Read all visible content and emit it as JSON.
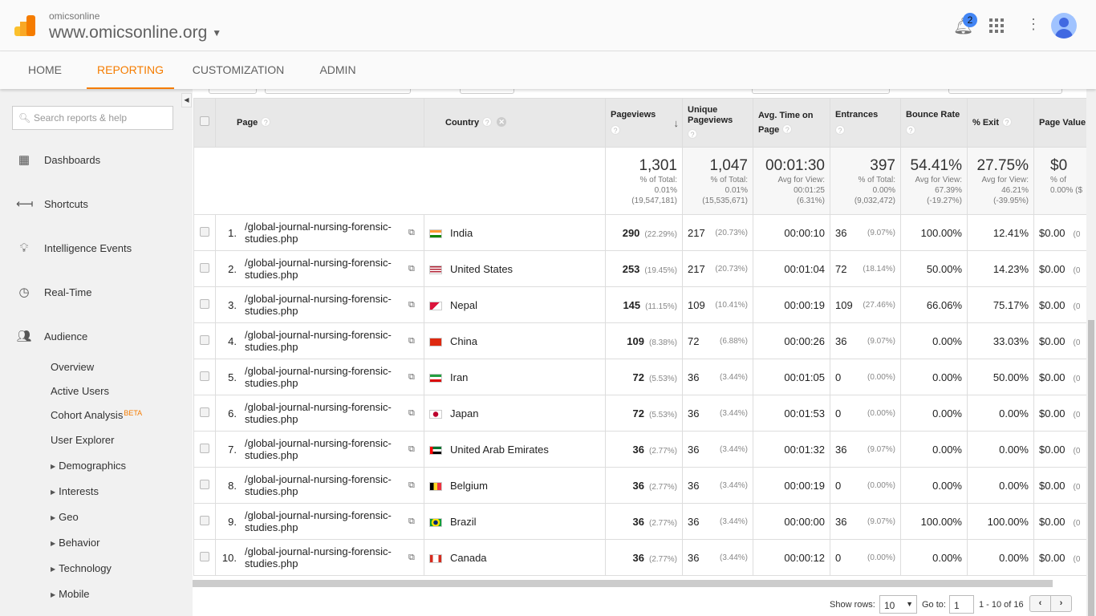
{
  "header": {
    "account": "omicsonline",
    "property": "www.omicsonline.org",
    "notifications": "2"
  },
  "nav": {
    "tabs": [
      "HOME",
      "REPORTING",
      "CUSTOMIZATION",
      "ADMIN"
    ],
    "active": "REPORTING"
  },
  "sidebar": {
    "search_placeholder": "Search reports & help",
    "items": [
      {
        "label": "Dashboards",
        "icon": "grid-icon"
      },
      {
        "label": "Shortcuts",
        "icon": "shortcut-arrow-icon"
      },
      {
        "label": "Intelligence Events",
        "icon": "lightbulb-icon"
      },
      {
        "label": "Real-Time",
        "icon": "clock-icon"
      },
      {
        "label": "Audience",
        "icon": "people-icon"
      }
    ],
    "subitems": [
      {
        "label": "Overview"
      },
      {
        "label": "Active Users"
      },
      {
        "label": "Cohort Analysis",
        "badge": "BETA"
      },
      {
        "label": "User Explorer"
      },
      {
        "label": "Demographics",
        "expandable": true
      },
      {
        "label": "Interests",
        "expandable": true
      },
      {
        "label": "Geo",
        "expandable": true
      },
      {
        "label": "Behavior",
        "expandable": true
      },
      {
        "label": "Technology",
        "expandable": true
      },
      {
        "label": "Mobile",
        "expandable": true
      }
    ]
  },
  "table": {
    "columns": {
      "page": "Page",
      "country": "Country",
      "pageviews": "Pageviews",
      "unique": "Unique Pageviews",
      "avgtime": "Avg. Time on Page",
      "entrances": "Entrances",
      "bounce": "Bounce Rate",
      "exit": "% Exit",
      "value": "Page Value"
    },
    "totals": {
      "pageviews": {
        "value": "1,301",
        "l1": "% of Total:",
        "l2": "0.01%",
        "l3": "(19,547,181)"
      },
      "unique": {
        "value": "1,047",
        "l1": "% of Total:",
        "l2": "0.01%",
        "l3": "(15,535,671)"
      },
      "avgtime": {
        "value": "00:01:30",
        "l1": "Avg for View:",
        "l2": "00:01:25",
        "l3": "(6.31%)"
      },
      "entrances": {
        "value": "397",
        "l1": "% of Total:",
        "l2": "0.00%",
        "l3": "(9,032,472)"
      },
      "bounce": {
        "value": "54.41%",
        "l1": "Avg for View:",
        "l2": "67.39%",
        "l3": "(-19.27%)"
      },
      "exit": {
        "value": "27.75%",
        "l1": "Avg for View:",
        "l2": "46.21%",
        "l3": "(-39.95%)"
      },
      "value": {
        "value": "$0",
        "l1": "% of",
        "l2": "0.00% ($"
      }
    },
    "rows": [
      {
        "n": "1.",
        "page": "/global-journal-nursing-forensic-studies.php",
        "country": "India",
        "flag": "in",
        "pv": "290",
        "pvp": "(22.29%)",
        "u": "217",
        "up": "(20.73%)",
        "t": "00:00:10",
        "e": "36",
        "ep": "(9.07%)",
        "b": "100.00%",
        "x": "12.41%",
        "v": "$0.00",
        "vp": "(0"
      },
      {
        "n": "2.",
        "page": "/global-journal-nursing-forensic-studies.php",
        "country": "United States",
        "flag": "us",
        "pv": "253",
        "pvp": "(19.45%)",
        "u": "217",
        "up": "(20.73%)",
        "t": "00:01:04",
        "e": "72",
        "ep": "(18.14%)",
        "b": "50.00%",
        "x": "14.23%",
        "v": "$0.00",
        "vp": "(0"
      },
      {
        "n": "3.",
        "page": "/global-journal-nursing-forensic-studies.php",
        "country": "Nepal",
        "flag": "np",
        "pv": "145",
        "pvp": "(11.15%)",
        "u": "109",
        "up": "(10.41%)",
        "t": "00:00:19",
        "e": "109",
        "ep": "(27.46%)",
        "b": "66.06%",
        "x": "75.17%",
        "v": "$0.00",
        "vp": "(0"
      },
      {
        "n": "4.",
        "page": "/global-journal-nursing-forensic-studies.php",
        "country": "China",
        "flag": "cn",
        "pv": "109",
        "pvp": "(8.38%)",
        "u": "72",
        "up": "(6.88%)",
        "t": "00:00:26",
        "e": "36",
        "ep": "(9.07%)",
        "b": "0.00%",
        "x": "33.03%",
        "v": "$0.00",
        "vp": "(0"
      },
      {
        "n": "5.",
        "page": "/global-journal-nursing-forensic-studies.php",
        "country": "Iran",
        "flag": "ir",
        "pv": "72",
        "pvp": "(5.53%)",
        "u": "36",
        "up": "(3.44%)",
        "t": "00:01:05",
        "e": "0",
        "ep": "(0.00%)",
        "b": "0.00%",
        "x": "50.00%",
        "v": "$0.00",
        "vp": "(0"
      },
      {
        "n": "6.",
        "page": "/global-journal-nursing-forensic-studies.php",
        "country": "Japan",
        "flag": "jp",
        "pv": "72",
        "pvp": "(5.53%)",
        "u": "36",
        "up": "(3.44%)",
        "t": "00:01:53",
        "e": "0",
        "ep": "(0.00%)",
        "b": "0.00%",
        "x": "0.00%",
        "v": "$0.00",
        "vp": "(0"
      },
      {
        "n": "7.",
        "page": "/global-journal-nursing-forensic-studies.php",
        "country": "United Arab Emirates",
        "flag": "ae",
        "pv": "36",
        "pvp": "(2.77%)",
        "u": "36",
        "up": "(3.44%)",
        "t": "00:01:32",
        "e": "36",
        "ep": "(9.07%)",
        "b": "0.00%",
        "x": "0.00%",
        "v": "$0.00",
        "vp": "(0"
      },
      {
        "n": "8.",
        "page": "/global-journal-nursing-forensic-studies.php",
        "country": "Belgium",
        "flag": "be",
        "pv": "36",
        "pvp": "(2.77%)",
        "u": "36",
        "up": "(3.44%)",
        "t": "00:00:19",
        "e": "0",
        "ep": "(0.00%)",
        "b": "0.00%",
        "x": "0.00%",
        "v": "$0.00",
        "vp": "(0"
      },
      {
        "n": "9.",
        "page": "/global-journal-nursing-forensic-studies.php",
        "country": "Brazil",
        "flag": "br",
        "pv": "36",
        "pvp": "(2.77%)",
        "u": "36",
        "up": "(3.44%)",
        "t": "00:00:00",
        "e": "36",
        "ep": "(9.07%)",
        "b": "100.00%",
        "x": "100.00%",
        "v": "$0.00",
        "vp": "(0"
      },
      {
        "n": "10.",
        "page": "/global-journal-nursing-forensic-studies.php",
        "country": "Canada",
        "flag": "ca",
        "pv": "36",
        "pvp": "(2.77%)",
        "u": "36",
        "up": "(3.44%)",
        "t": "00:00:12",
        "e": "0",
        "ep": "(0.00%)",
        "b": "0.00%",
        "x": "0.00%",
        "v": "$0.00",
        "vp": "(0"
      }
    ]
  },
  "pager": {
    "show_rows_label": "Show rows:",
    "rows": "10",
    "goto_label": "Go to:",
    "goto": "1",
    "range": "1 - 10 of 16"
  },
  "colors": {
    "accent": "#f57c00",
    "badge": "#4285f4"
  }
}
